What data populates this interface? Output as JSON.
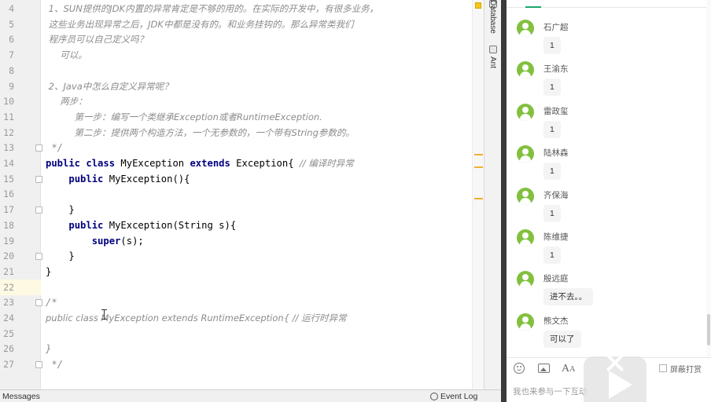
{
  "editor": {
    "lines": [
      {
        "num": "4",
        "text": " 1、SUN提供的JDK内置的异常肯定是不够的用的。在实际的开发中，有很多业务，",
        "kind": "comment"
      },
      {
        "num": "5",
        "text": " 这些业务出现异常之后，JDK中都是没有的。和业务挂钩的。那么异常类我们",
        "kind": "comment"
      },
      {
        "num": "6",
        "text": " 程序员可以自己定义吗？",
        "kind": "comment"
      },
      {
        "num": "7",
        "text": "     可以。",
        "kind": "comment"
      },
      {
        "num": "8",
        "text": "",
        "kind": "blank"
      },
      {
        "num": "9",
        "text": " 2、Java中怎么自定义异常呢？",
        "kind": "comment"
      },
      {
        "num": "10",
        "text": "     两步：",
        "kind": "comment"
      },
      {
        "num": "11",
        "text": "          第一步：编写一个类继承Exception或者RuntimeException.",
        "kind": "comment"
      },
      {
        "num": "12",
        "text": "          第二步：提供两个构造方法，一个无参数的，一个带有String参数的。",
        "kind": "comment"
      },
      {
        "num": "13",
        "text": " */",
        "kind": "comment"
      },
      {
        "num": "14",
        "code": [
          {
            "t": "public ",
            "c": "kw"
          },
          {
            "t": "class ",
            "c": "kw"
          },
          {
            "t": "MyException ",
            "c": "ident"
          },
          {
            "t": "extends ",
            "c": "kw"
          },
          {
            "t": "Exception{ ",
            "c": "cls"
          },
          {
            "t": "// 编译时异常",
            "c": "cm"
          }
        ],
        "kind": "code"
      },
      {
        "num": "15",
        "code": [
          {
            "t": "    ",
            "c": "cls"
          },
          {
            "t": "public ",
            "c": "kw"
          },
          {
            "t": "MyException(){",
            "c": "ident"
          }
        ],
        "kind": "code"
      },
      {
        "num": "16",
        "text": "",
        "kind": "blank"
      },
      {
        "num": "17",
        "code": [
          {
            "t": "    }",
            "c": "cls"
          }
        ],
        "kind": "code"
      },
      {
        "num": "18",
        "code": [
          {
            "t": "    ",
            "c": "cls"
          },
          {
            "t": "public ",
            "c": "kw"
          },
          {
            "t": "MyException(String s){",
            "c": "ident"
          }
        ],
        "kind": "code"
      },
      {
        "num": "19",
        "code": [
          {
            "t": "        ",
            "c": "cls"
          },
          {
            "t": "super",
            "c": "kw"
          },
          {
            "t": "(s);",
            "c": "cls"
          }
        ],
        "kind": "code"
      },
      {
        "num": "20",
        "code": [
          {
            "t": "    }",
            "c": "cls"
          }
        ],
        "kind": "code"
      },
      {
        "num": "21",
        "code": [
          {
            "t": "}",
            "c": "cls"
          }
        ],
        "kind": "code"
      },
      {
        "num": "22",
        "text": "",
        "kind": "blank"
      },
      {
        "num": "23",
        "text": "/*",
        "kind": "comment"
      },
      {
        "num": "24",
        "text": "public class MyException extends RuntimeException{ // 运行时异常",
        "kind": "comment"
      },
      {
        "num": "25",
        "text": "",
        "kind": "blank"
      },
      {
        "num": "26",
        "text": "}",
        "kind": "comment"
      },
      {
        "num": "27",
        "text": " */",
        "kind": "comment"
      }
    ]
  },
  "toolstrip": {
    "database": "Database",
    "ant": "Ant"
  },
  "statusbar": {
    "messages": "Messages",
    "event_log": "Event Log"
  },
  "chat": {
    "messages": [
      {
        "sender": "石广超",
        "text": "1"
      },
      {
        "sender": "王渝东",
        "text": "1"
      },
      {
        "sender": "雷政玺",
        "text": "1"
      },
      {
        "sender": "陆林森",
        "text": "1"
      },
      {
        "sender": "齐保海",
        "text": "1"
      },
      {
        "sender": "陈维捷",
        "text": "1"
      },
      {
        "sender": "殷远庭",
        "text": "进不去。。"
      },
      {
        "sender": "熊文杰",
        "text": "可以了"
      }
    ],
    "block_label": "屏蔽打赏",
    "input_placeholder": "我也来参与一下互动"
  },
  "colors": {
    "avatar": "#82c03d",
    "keyword": "#000080",
    "comment": "#8c8c8c",
    "current_line": "#fdf9e3"
  }
}
